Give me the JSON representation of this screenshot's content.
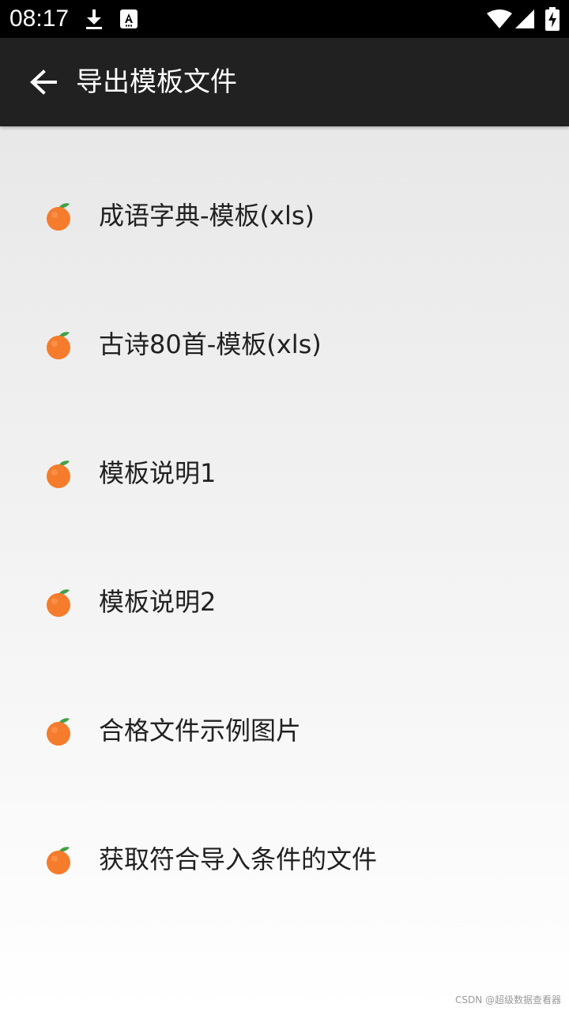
{
  "status_bar": {
    "time": "08:17",
    "icons": [
      "download-icon",
      "app-notification-icon",
      "wifi-icon",
      "signal-icon",
      "battery-charging-icon"
    ]
  },
  "app_bar": {
    "back_icon": "arrow-back-icon",
    "title": "导出模板文件"
  },
  "list": {
    "items": [
      {
        "label": "成语字典-模板(xls)",
        "icon": "orange-icon"
      },
      {
        "label": "古诗80首-模板(xls)",
        "icon": "orange-icon"
      },
      {
        "label": "模板说明1",
        "icon": "orange-icon"
      },
      {
        "label": "模板说明2",
        "icon": "orange-icon"
      },
      {
        "label": "合格文件示例图片",
        "icon": "orange-icon"
      },
      {
        "label": "获取符合导入条件的文件",
        "icon": "orange-icon"
      }
    ]
  },
  "watermark": "CSDN @超级数据查看器",
  "colors": {
    "status_bar_bg": "#000000",
    "app_bar_bg": "#212121",
    "orange": "#F57C2C",
    "leaf": "#4CAF50"
  }
}
